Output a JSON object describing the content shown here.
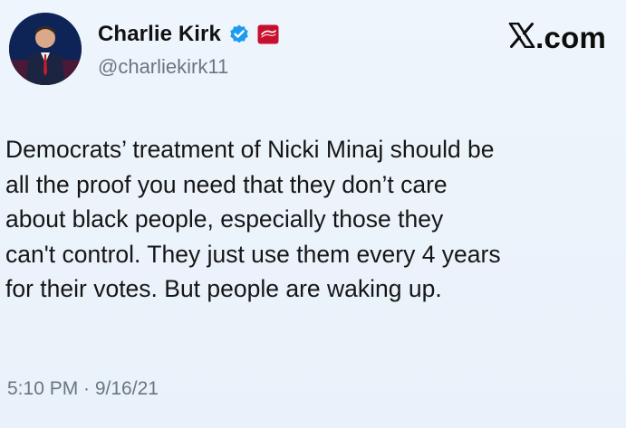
{
  "author": {
    "display_name": "Charlie Kirk",
    "handle": "@charliekirk11",
    "avatar_icon": "profile-photo",
    "verified_icon": "verified-badge-icon",
    "affiliate_icon": "affiliation-badge-icon",
    "colors": {
      "verified": "#1d9bf0",
      "affiliate": "#c8102e"
    }
  },
  "brand": {
    "logo_letter": "X",
    "suffix": ".com"
  },
  "tweet": {
    "lines": [
      "Democrats’ treatment of Nicki Minaj should be",
      "all the proof you need that they don’t care",
      "about black people, especially those they",
      "can't control. They just use them every 4 years",
      "for their votes. But people are waking up."
    ],
    "timestamp": "5:10 PM · 9/16/21"
  }
}
